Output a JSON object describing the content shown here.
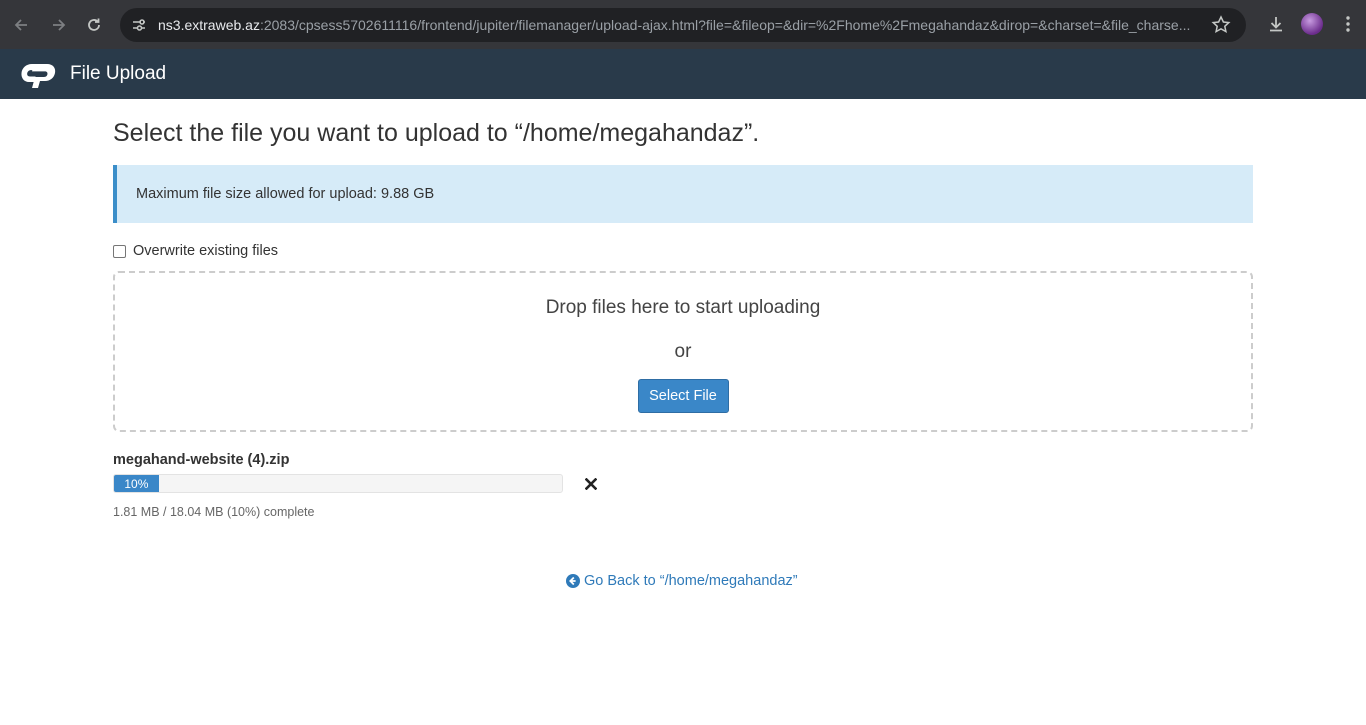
{
  "browser": {
    "url_host": "ns3.extraweb.az",
    "url_rest": ":2083/cpsess5702611116/frontend/jupiter/filemanager/upload-ajax.html?file=&fileop=&dir=%2Fhome%2Fmegahandaz&dirop=&charset=&file_charse..."
  },
  "header": {
    "title": "File Upload"
  },
  "main": {
    "title": "Select the file you want to upload to “/home/megahandaz”.",
    "info": "Maximum file size allowed for upload: 9.88 GB",
    "overwrite_label": "Overwrite existing files",
    "drop_text": "Drop files here to start uploading",
    "or_text": "or",
    "select_button": "Select File"
  },
  "upload": {
    "file_name": "megahand-website (4).zip",
    "progress_label": "10%",
    "progress": 0.1,
    "status": "1.81 MB / 18.04 MB (10%) complete"
  },
  "footer": {
    "go_back": "Go Back to “/home/megahandaz”"
  },
  "colors": {
    "header_bg": "#293a4a",
    "accent": "#3a87c8",
    "info_bg": "#d6ebf8",
    "link": "#2f7ab9"
  }
}
